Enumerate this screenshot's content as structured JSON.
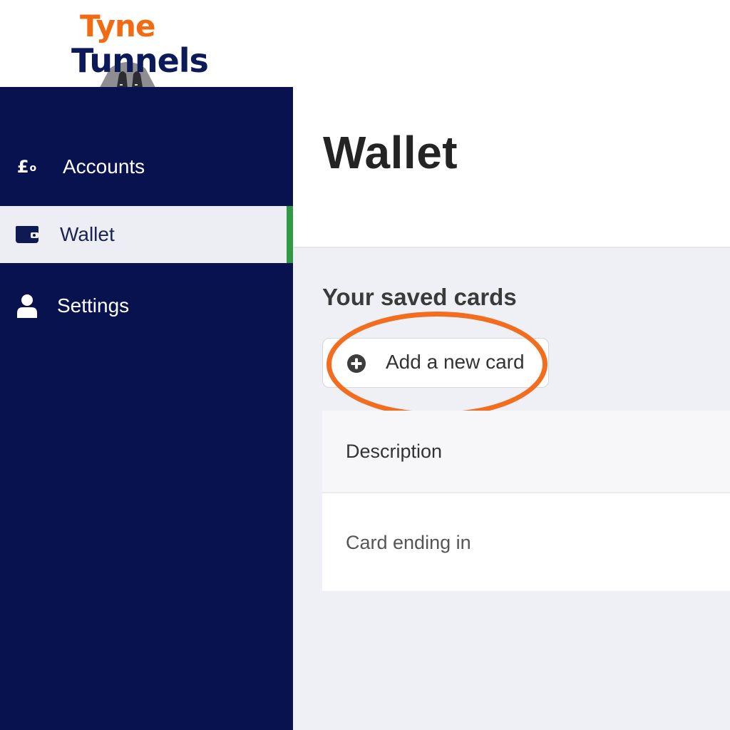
{
  "brand": {
    "logo_line1": "Tyne",
    "logo_line2": "Tunnels",
    "primary_color": "#08124f",
    "accent_color": "#f26a12",
    "active_indicator_color": "#2f9a43"
  },
  "sidebar": {
    "items": [
      {
        "label": "Accounts",
        "icon": "pound-coin-icon",
        "active": false
      },
      {
        "label": "Wallet",
        "icon": "wallet-icon",
        "active": true
      },
      {
        "label": "Settings",
        "icon": "user-icon",
        "active": false
      }
    ]
  },
  "main": {
    "title": "Wallet",
    "section_title": "Your saved cards",
    "add_card_label": "Add a new card",
    "add_card_icon": "plus-circle-icon",
    "highlight_color": "#f26e1e",
    "table": {
      "header": "Description",
      "rows": [
        "Card ending in"
      ]
    }
  }
}
